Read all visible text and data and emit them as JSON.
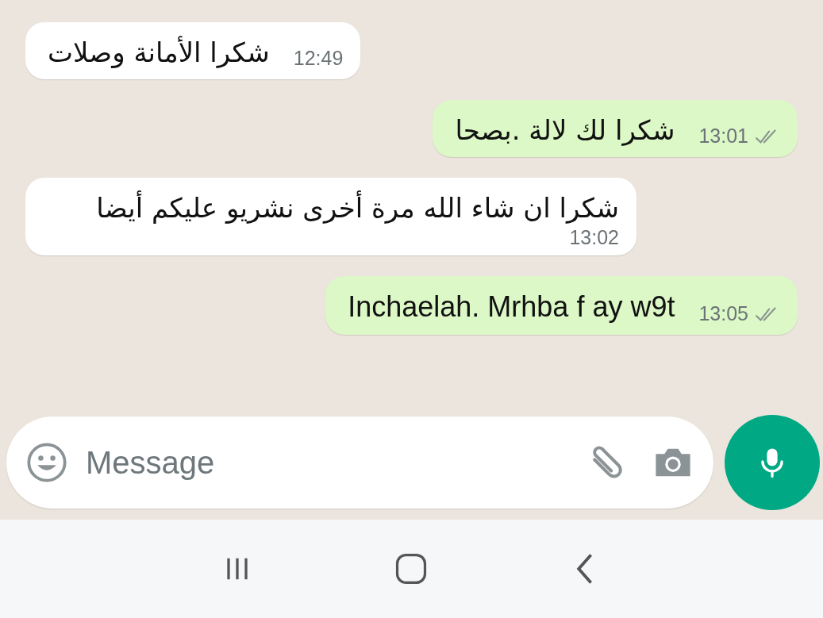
{
  "messages": [
    {
      "kind": "incoming",
      "text": "شكرا الأمانة وصلات",
      "time": "12:49"
    },
    {
      "kind": "outgoing",
      "text": "شكرا لك لالة .بصحا",
      "time": "13:01",
      "read": false
    },
    {
      "kind": "incoming",
      "text": "شكرا ان شاء الله مرة أخرى نشريو عليكم أيضا",
      "time": "13:02"
    },
    {
      "kind": "outgoing",
      "text": "Inchaelah. Mrhba f ay w9t",
      "time": "13:05",
      "read": false
    }
  ],
  "composer": {
    "placeholder": "Message"
  }
}
